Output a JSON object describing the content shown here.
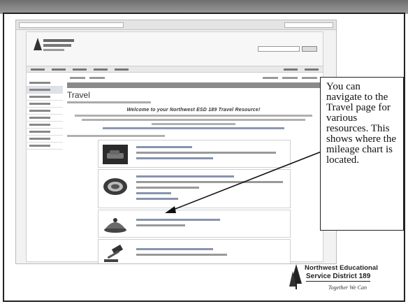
{
  "site": {
    "page_title": "Travel",
    "welcome": "Welcome to your Northwest ESD 189 Travel Resource!"
  },
  "callout": {
    "text": "You can navigate to the Travel page for various resources. This shows where the mileage chart is located."
  },
  "brand": {
    "line1": "Northwest Educational",
    "line2": "Service District 189",
    "tagline": "Together We Can"
  },
  "colors": {
    "slide_border": "#222222",
    "arrow": "#111111",
    "nav_band": "#8a8a8a"
  }
}
